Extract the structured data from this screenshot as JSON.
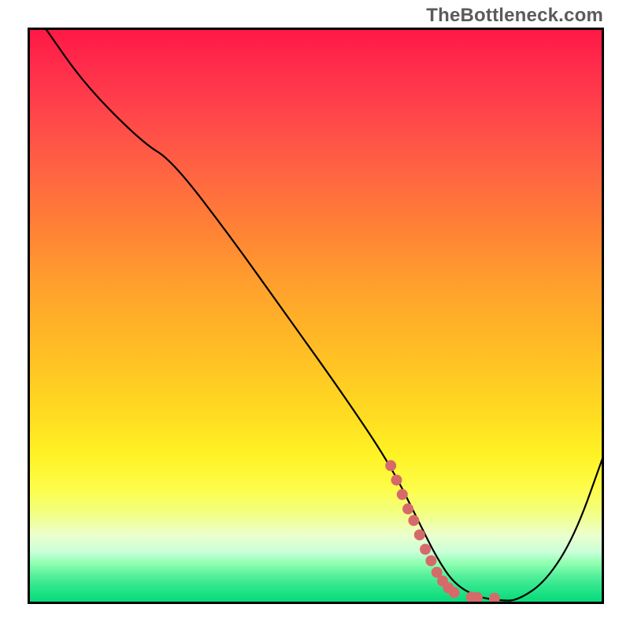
{
  "watermark": "TheBottleneck.com",
  "chart_data": {
    "type": "line",
    "title": "",
    "xlabel": "",
    "ylabel": "",
    "xlim": [
      0,
      100
    ],
    "ylim": [
      0,
      100
    ],
    "grid": false,
    "series": [
      {
        "name": "bottleneck-curve",
        "color": "#000000",
        "x": [
          3,
          10,
          20,
          25,
          35,
          45,
          55,
          63,
          68,
          71,
          74,
          78,
          82,
          85,
          90,
          95,
          100
        ],
        "values": [
          100,
          90,
          80,
          77,
          64,
          50,
          36,
          24,
          14,
          8,
          3.5,
          1.2,
          0.6,
          0.6,
          4,
          12,
          26
        ]
      },
      {
        "name": "highlight-dots",
        "color": "#d66a6a",
        "type": "scatter",
        "x": [
          63,
          64,
          65,
          66,
          67,
          68,
          69,
          70,
          71,
          72,
          73,
          74,
          77,
          78,
          81
        ],
        "values": [
          24,
          21.5,
          19,
          16.5,
          14.5,
          12,
          9.5,
          7.5,
          5.5,
          4,
          2.8,
          2,
          1.2,
          1.1,
          1.0
        ]
      }
    ]
  }
}
